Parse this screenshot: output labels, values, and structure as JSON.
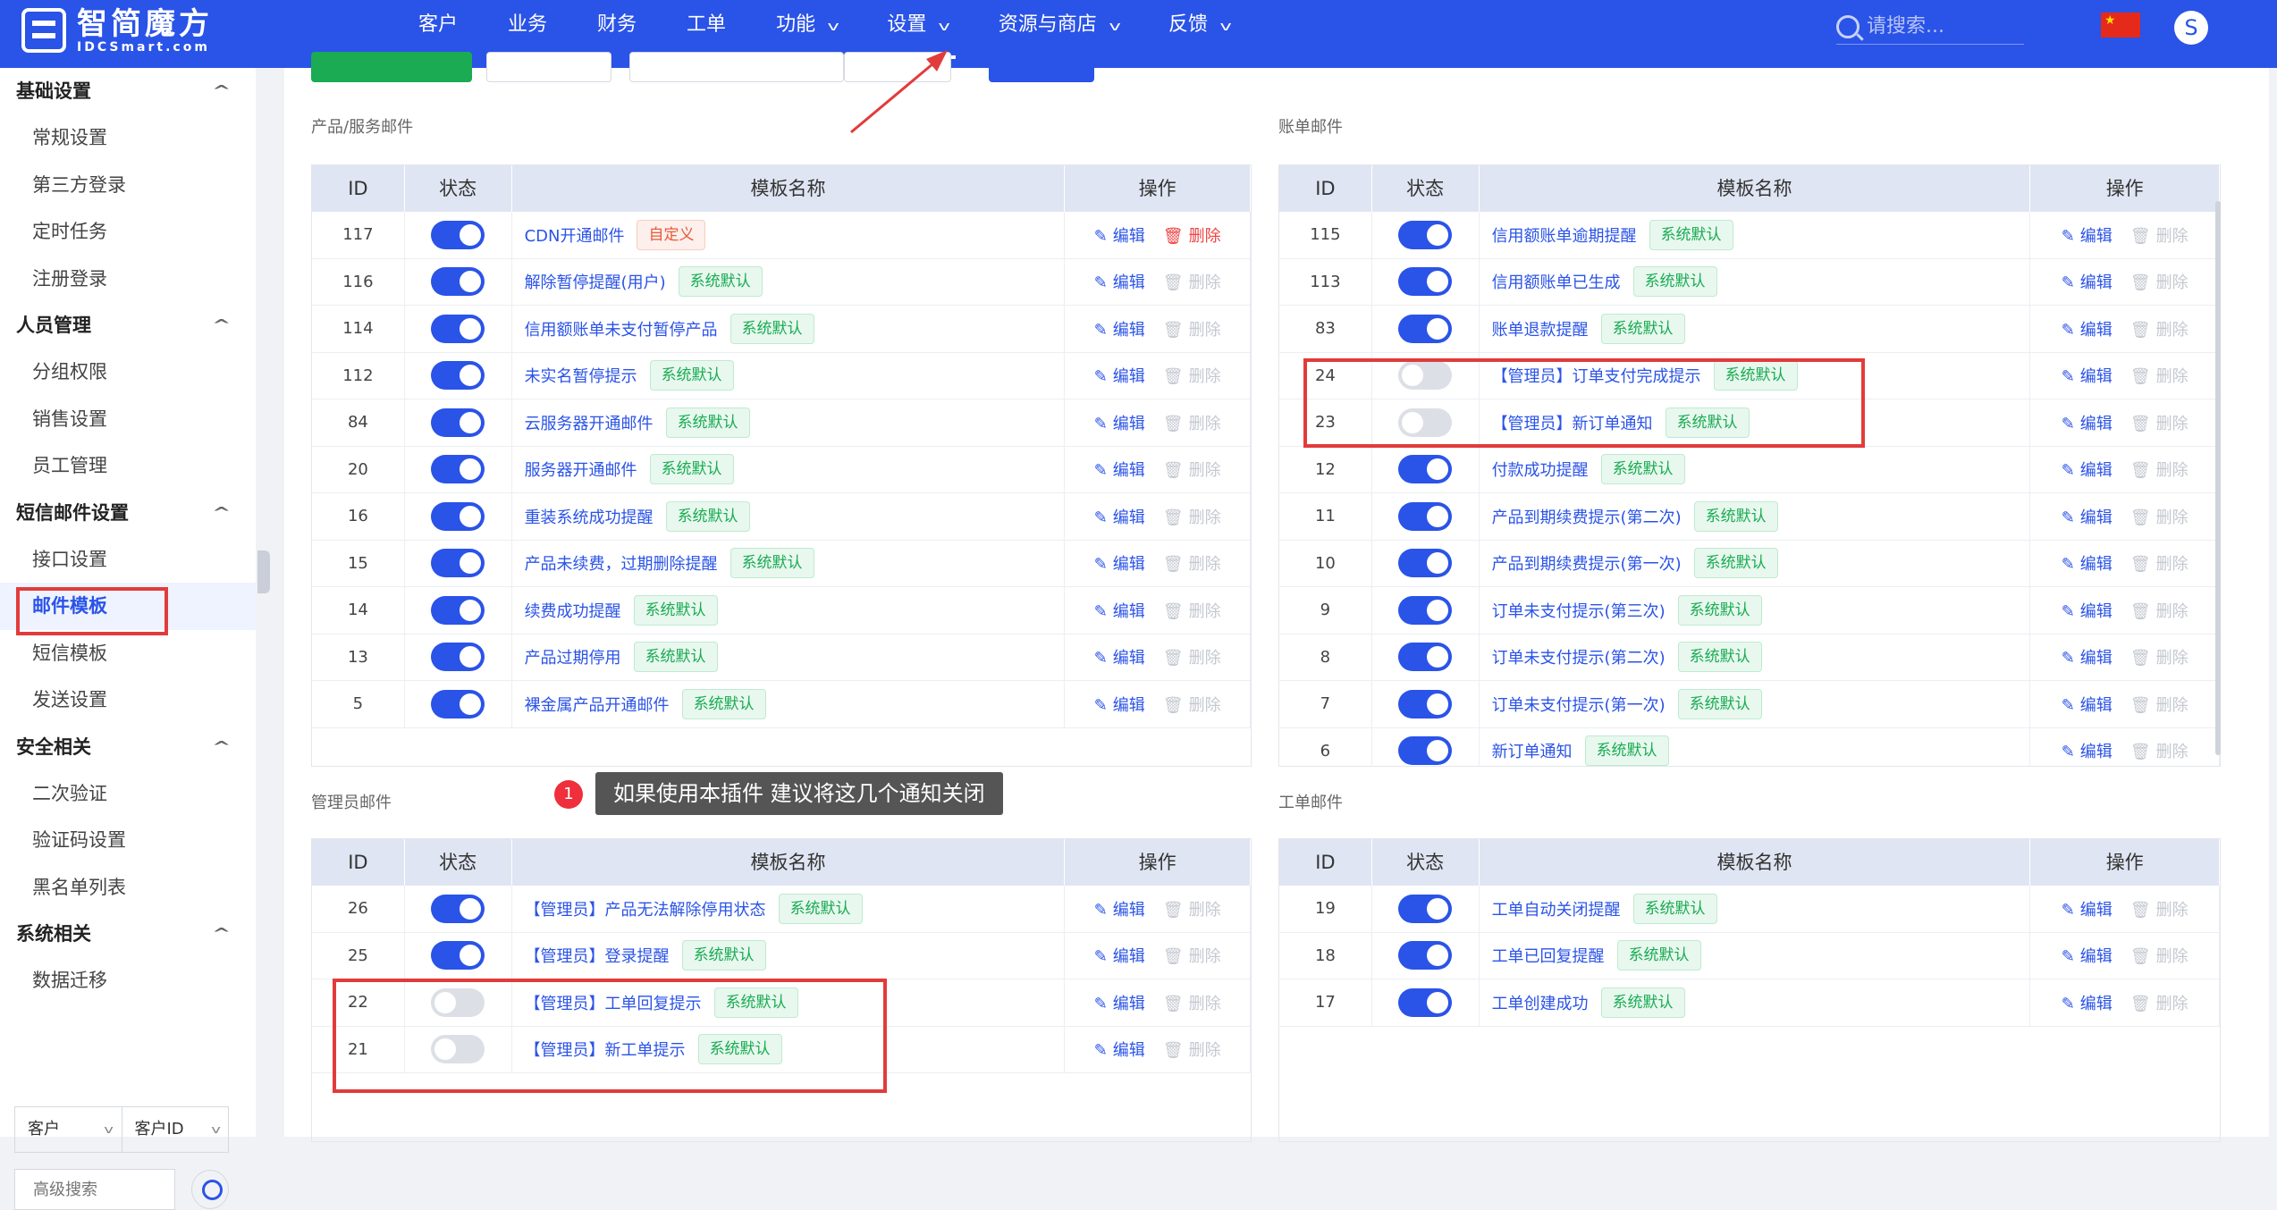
{
  "brand": {
    "name_cn": "智简魔方",
    "name_en": "IDCSmart.com"
  },
  "nav": [
    {
      "label": "客户",
      "chevron": false
    },
    {
      "label": "业务",
      "chevron": false
    },
    {
      "label": "财务",
      "chevron": false
    },
    {
      "label": "工单",
      "chevron": false
    },
    {
      "label": "功能",
      "chevron": true
    },
    {
      "label": "设置",
      "chevron": true,
      "active": true
    },
    {
      "label": "资源与商店",
      "chevron": true
    },
    {
      "label": "反馈",
      "chevron": true
    }
  ],
  "search": {
    "placeholder": "请搜索..."
  },
  "avatar": "S",
  "sidebar": [
    {
      "group": "基础设置",
      "items": [
        "常规设置",
        "第三方登录",
        "定时任务",
        "注册登录"
      ]
    },
    {
      "group": "人员管理",
      "items": [
        "分组权限",
        "销售设置",
        "员工管理"
      ]
    },
    {
      "group": "短信邮件设置",
      "items": [
        "接口设置",
        "邮件模板",
        "短信模板",
        "发送设置"
      ]
    },
    {
      "group": "安全相关",
      "items": [
        "二次验证",
        "验证码设置",
        "黑名单列表"
      ]
    },
    {
      "group": "系统相关",
      "items": [
        "数据迁移"
      ]
    }
  ],
  "sidebar_active": "邮件模板",
  "sidebar_bottom": {
    "select1": "客户",
    "select2": "客户ID",
    "adv_placeholder": "高级搜索"
  },
  "columns": {
    "id": "ID",
    "status": "状态",
    "name": "模板名称",
    "op": "操作"
  },
  "actions": {
    "edit": "编辑",
    "delete": "删除"
  },
  "tags": {
    "system": "系统默认",
    "custom": "自定义"
  },
  "sections": {
    "product": {
      "label": "产品/服务邮件",
      "rows": [
        {
          "id": "117",
          "on": true,
          "name": "CDN开通邮件",
          "tag": "custom"
        },
        {
          "id": "116",
          "on": true,
          "name": "解除暂停提醒(用户)",
          "tag": "system"
        },
        {
          "id": "114",
          "on": true,
          "name": "信用额账单未支付暂停产品",
          "tag": "system"
        },
        {
          "id": "112",
          "on": true,
          "name": "未实名暂停提示",
          "tag": "system"
        },
        {
          "id": "84",
          "on": true,
          "name": "云服务器开通邮件",
          "tag": "system"
        },
        {
          "id": "20",
          "on": true,
          "name": "服务器开通邮件",
          "tag": "system"
        },
        {
          "id": "16",
          "on": true,
          "name": "重装系统成功提醒",
          "tag": "system"
        },
        {
          "id": "15",
          "on": true,
          "name": "产品未续费，过期删除提醒",
          "tag": "system"
        },
        {
          "id": "14",
          "on": true,
          "name": "续费成功提醒",
          "tag": "system"
        },
        {
          "id": "13",
          "on": true,
          "name": "产品过期停用",
          "tag": "system"
        },
        {
          "id": "5",
          "on": true,
          "name": "裸金属产品开通邮件",
          "tag": "system"
        }
      ]
    },
    "bill": {
      "label": "账单邮件",
      "rows": [
        {
          "id": "115",
          "on": true,
          "name": "信用额账单逾期提醒",
          "tag": "system"
        },
        {
          "id": "113",
          "on": true,
          "name": "信用额账单已生成",
          "tag": "system"
        },
        {
          "id": "83",
          "on": true,
          "name": "账单退款提醒",
          "tag": "system"
        },
        {
          "id": "24",
          "on": false,
          "name": "【管理员】订单支付完成提示",
          "tag": "system"
        },
        {
          "id": "23",
          "on": false,
          "name": "【管理员】新订单通知",
          "tag": "system"
        },
        {
          "id": "12",
          "on": true,
          "name": "付款成功提醒",
          "tag": "system"
        },
        {
          "id": "11",
          "on": true,
          "name": "产品到期续费提示(第二次)",
          "tag": "system"
        },
        {
          "id": "10",
          "on": true,
          "name": "产品到期续费提示(第一次)",
          "tag": "system"
        },
        {
          "id": "9",
          "on": true,
          "name": "订单未支付提示(第三次)",
          "tag": "system"
        },
        {
          "id": "8",
          "on": true,
          "name": "订单未支付提示(第二次)",
          "tag": "system"
        },
        {
          "id": "7",
          "on": true,
          "name": "订单未支付提示(第一次)",
          "tag": "system"
        },
        {
          "id": "6",
          "on": true,
          "name": "新订单通知",
          "tag": "system"
        }
      ]
    },
    "admin": {
      "label": "管理员邮件",
      "rows": [
        {
          "id": "26",
          "on": true,
          "name": "【管理员】产品无法解除停用状态",
          "tag": "system"
        },
        {
          "id": "25",
          "on": true,
          "name": "【管理员】登录提醒",
          "tag": "system"
        },
        {
          "id": "22",
          "on": false,
          "name": "【管理员】工单回复提示",
          "tag": "system"
        },
        {
          "id": "21",
          "on": false,
          "name": "【管理员】新工单提示",
          "tag": "system"
        }
      ]
    },
    "ticket": {
      "label": "工单邮件",
      "rows": [
        {
          "id": "19",
          "on": true,
          "name": "工单自动关闭提醒",
          "tag": "system"
        },
        {
          "id": "18",
          "on": true,
          "name": "工单已回复提醒",
          "tag": "system"
        },
        {
          "id": "17",
          "on": true,
          "name": "工单创建成功",
          "tag": "system"
        }
      ]
    }
  },
  "annotation": {
    "badge": "1",
    "text": "如果使用本插件 建议将这几个通知关闭"
  },
  "colors": {
    "primary": "#2a53e8",
    "success": "#1aab53",
    "danger": "#e23b3b"
  }
}
